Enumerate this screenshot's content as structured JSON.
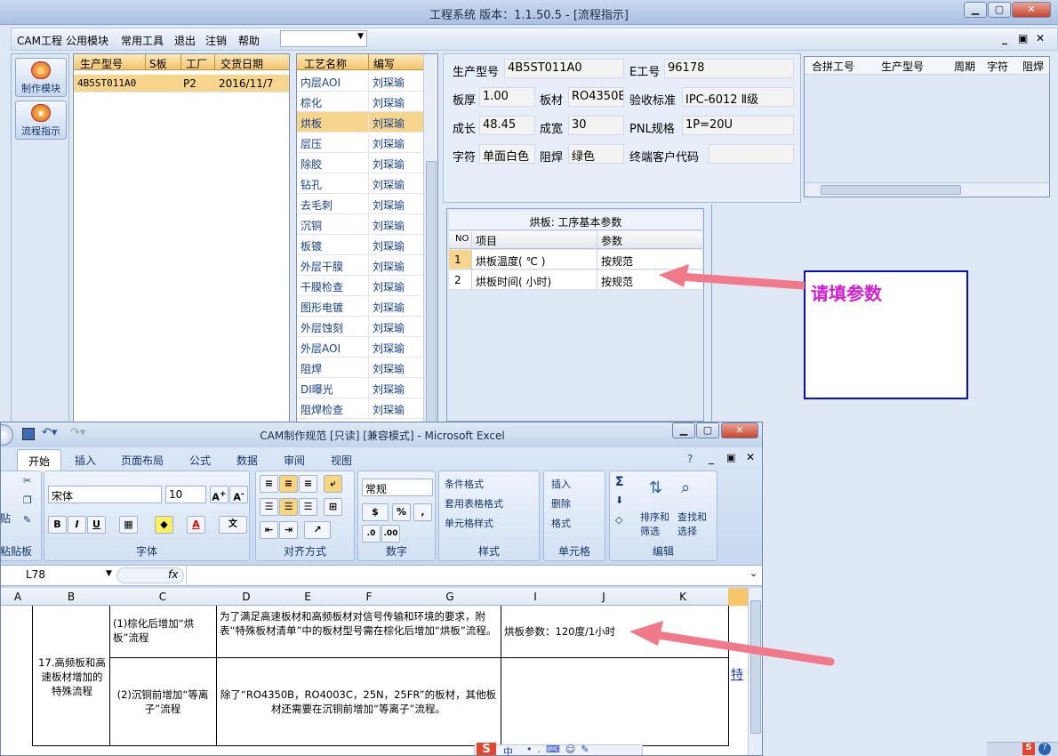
{
  "window": {
    "title": "工程系统   版本：1.1.50.5 - [流程指示]",
    "min": "▁",
    "max": "▢",
    "close": "✕"
  },
  "menubar": {
    "items": [
      "CAM工程",
      "公用模块",
      "常用工具",
      "退出",
      "注销",
      "帮助"
    ],
    "combo_value": "",
    "mdi_min": "_",
    "mdi_restore": "▣",
    "mdi_close": "✕"
  },
  "leftpanel": {
    "buttons": [
      {
        "label": "制作模块",
        "icon": "flame-icon"
      },
      {
        "label": "流程指示",
        "icon": "process-icon"
      }
    ]
  },
  "model_grid": {
    "headers": [
      "生产型号",
      "S板",
      "工厂",
      "交货日期"
    ],
    "rows": [
      [
        "4B5ST011A0",
        "",
        "P2",
        "2016/11/7"
      ]
    ]
  },
  "process_grid": {
    "headers": [
      "工艺名称",
      "编写"
    ],
    "rows": [
      [
        "内层AOI",
        "刘琛瑜"
      ],
      [
        "棕化",
        "刘琛瑜"
      ],
      [
        "烘板",
        "刘琛瑜"
      ],
      [
        "层压",
        "刘琛瑜"
      ],
      [
        "除胶",
        "刘琛瑜"
      ],
      [
        "钻孔",
        "刘琛瑜"
      ],
      [
        "去毛刺",
        "刘琛瑜"
      ],
      [
        "沉铜",
        "刘琛瑜"
      ],
      [
        "板镀",
        "刘琛瑜"
      ],
      [
        "外层干膜",
        "刘琛瑜"
      ],
      [
        "干膜检查",
        "刘琛瑜"
      ],
      [
        "图形电镀",
        "刘琛瑜"
      ],
      [
        "外层蚀刻",
        "刘琛瑜"
      ],
      [
        "外层AOI",
        "刘琛瑜"
      ],
      [
        "阻焊",
        "刘琛瑜"
      ],
      [
        "DI曝光",
        "刘琛瑜"
      ],
      [
        "阻焊检查",
        "刘琛瑜"
      ]
    ],
    "selected_index": 2
  },
  "info": {
    "product_label": "生产型号",
    "product": "4B5ST011A0",
    "eno_label": "E工号",
    "eno": "96178",
    "thick_label": "板厚",
    "thick": "1.00",
    "material_label": "板材",
    "material": "RO4350B",
    "std_label": "验收标准",
    "std": "IPC-6012 Ⅱ级",
    "len_label": "成长",
    "len": "48.45",
    "wid_label": "成宽",
    "wid": "30",
    "pnl_label": "PNL规格",
    "pnl": "1P=20U",
    "char_label": "字符",
    "char": "单面白色",
    "mask_label": "阻焊",
    "mask": "绿色",
    "cust_label": "终端客户代码",
    "cust": ""
  },
  "merge_grid": {
    "headers": [
      "合拼工号",
      "生产型号",
      "周期",
      "字符",
      "阻焊"
    ]
  },
  "param_grid": {
    "title": "烘板: 工序基本参数",
    "headers": [
      "NO",
      "项目",
      "参数"
    ],
    "rows": [
      [
        "1",
        "烘板温度( ℃ )",
        "按规范"
      ],
      [
        "2",
        "烘板时间( 小时)",
        "按规范"
      ]
    ]
  },
  "note": {
    "text": "请填参数"
  },
  "excel": {
    "title": "CAM制作规范 [只读] [兼容模式] - Microsoft Excel",
    "tabs": [
      "开始",
      "插入",
      "页面布局",
      "公式",
      "数据",
      "审阅",
      "视图"
    ],
    "font_name": "宋体",
    "font_size": "10",
    "number_format": "常规",
    "groups": {
      "clipboard": "粘贴板",
      "font": "字体",
      "align": "对齐方式",
      "number": "数字",
      "styles": "样式",
      "cells": "单元格",
      "edit": "编辑"
    },
    "paste_label": "贴",
    "styles_btns": [
      "条件格式",
      "套用表格格式",
      "单元格样式"
    ],
    "cells_btns": [
      "插入",
      "删除",
      "格式"
    ],
    "edit_btns": [
      "排序和\n筛选",
      "查找和\n选择"
    ],
    "name_box": "L78",
    "fx": "fx",
    "columns": [
      "A",
      "B",
      "C",
      "D",
      "E",
      "F",
      "G",
      "I",
      "J",
      "K"
    ],
    "cells": {
      "b": "17.高频板和高速板材增加的特殊流程",
      "c1": "(1)棕化后增加“烘板”流程",
      "d1": "为了满足高速板材和高频板材对信号传输和环境的要求，附表“特殊板材清单”中的板材型号需在棕化后增加“烘板”流程。",
      "i1": "烘板参数：120度/1小时",
      "c2": "(2)沉铜前增加“等离子”流程",
      "d2": "除了“RO4350B，RO4003C，25N，25FR”的板材，其他板材还需要在沉铜前增加“等离子”流程。",
      "l2": "特"
    },
    "ime": "中"
  },
  "colors": {
    "arrow": "#f07a8a",
    "note_border": "#0a0ad0",
    "note_text": "#d020d0",
    "header": "#f4c46f",
    "selected": "#f7d58c"
  }
}
